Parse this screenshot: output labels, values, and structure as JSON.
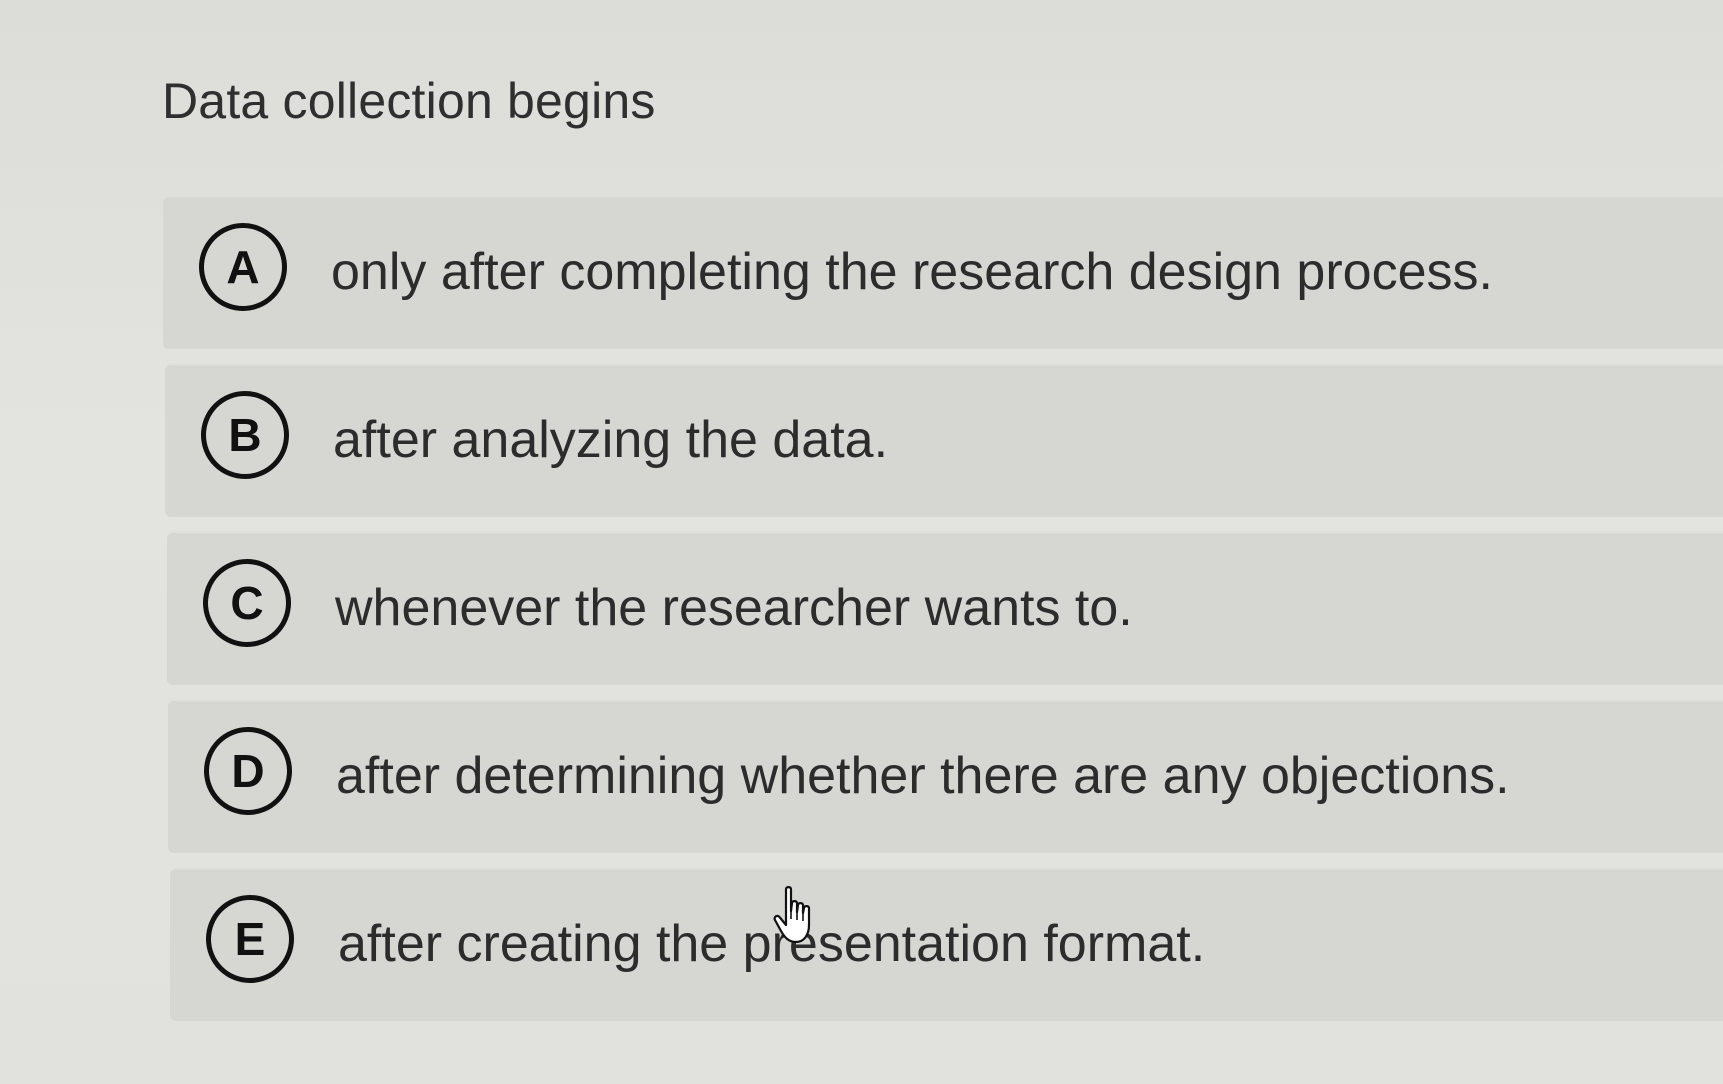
{
  "question": {
    "title": "Data collection begins"
  },
  "options": [
    {
      "letter": "A",
      "text": "only after completing the research design process."
    },
    {
      "letter": "B",
      "text": "after analyzing the data."
    },
    {
      "letter": "C",
      "text": "whenever the researcher wants to."
    },
    {
      "letter": "D",
      "text": "after determining whether there are any objections."
    },
    {
      "letter": "E",
      "text": "after creating the presentation format."
    }
  ],
  "cursor": {
    "icon": "hand-pointer-icon"
  },
  "colors": {
    "background": "#e0e0dc",
    "option_background": "#d6d6d2",
    "badge_border": "#111111",
    "text": "#2c2c2c"
  }
}
